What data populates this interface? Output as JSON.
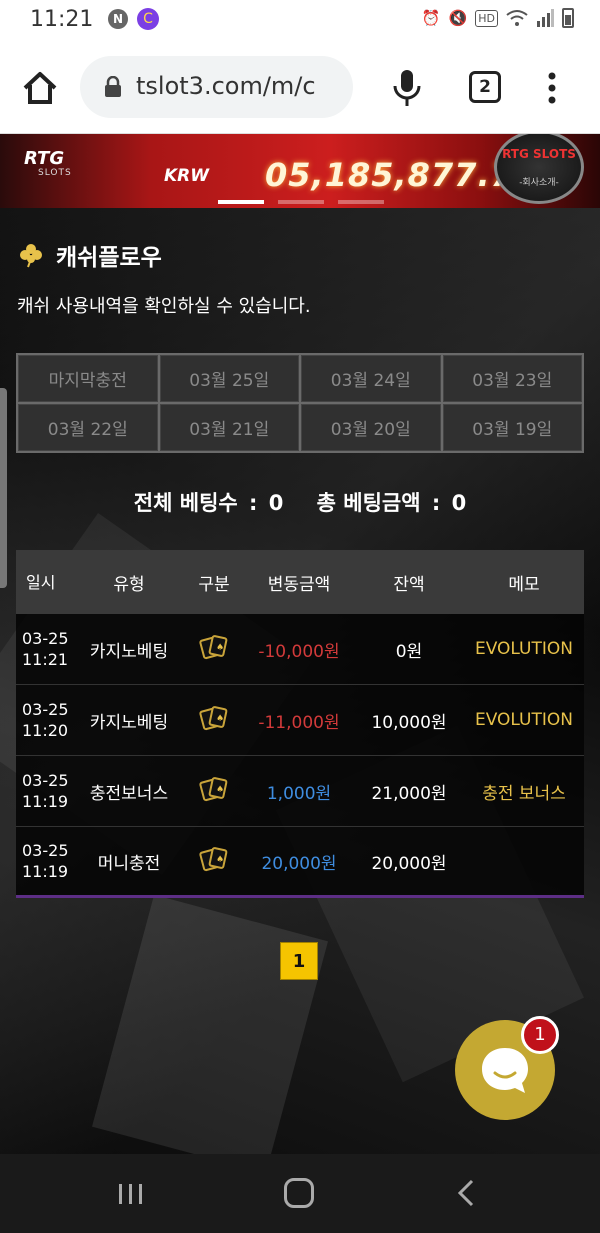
{
  "status_bar": {
    "time": "11:21",
    "notif_n": "N",
    "notif_c": "C",
    "hd_label": "HD"
  },
  "browser": {
    "url": "tslot3.com/m/c",
    "tab_count": "2"
  },
  "banner": {
    "logo": "RTG",
    "logo_sub": "SLOTS",
    "currency": "KRW",
    "jackpot": "05,185,877.7",
    "badge_title": "RTG SLOTS",
    "badge_link": "-회사소개-"
  },
  "section": {
    "title": "캐쉬플로우",
    "description": "캐쉬 사용내역을 확인하실 수 있습니다."
  },
  "date_filters": [
    "마지막충전",
    "03월 25일",
    "03월 24일",
    "03월 23일",
    "03월 22일",
    "03월 21일",
    "03월 20일",
    "03월 19일"
  ],
  "summary": {
    "total_bets_label": "전체 베팅수",
    "total_bets_value": "0",
    "total_amount_label": "총 베팅금액",
    "total_amount_value": "0"
  },
  "table": {
    "headers": [
      "일시",
      "유형",
      "구분",
      "변동금액",
      "잔액",
      "메모"
    ],
    "rows": [
      {
        "date": "03-25",
        "time": "11:21",
        "type": "카지노베팅",
        "category_icon": "cards-icon",
        "change": "-10,000원",
        "balance": "0원",
        "memo": "EVOLUTION"
      },
      {
        "date": "03-25",
        "time": "11:20",
        "type": "카지노베팅",
        "category_icon": "cards-icon",
        "change": "-11,000원",
        "balance": "10,000원",
        "memo": "EVOLUTION"
      },
      {
        "date": "03-25",
        "time": "11:19",
        "type": "충전보너스",
        "category_icon": "cards-icon",
        "change": "1,000원",
        "balance": "21,000원",
        "memo": "충전 보너스"
      },
      {
        "date": "03-25",
        "time": "11:19",
        "type": "머니충전",
        "category_icon": "cards-icon",
        "change": "20,000원",
        "balance": "20,000원",
        "memo": ""
      }
    ]
  },
  "pagination": {
    "current": "1"
  },
  "chat": {
    "unread": "1"
  },
  "colors": {
    "negative": "#d23a3a",
    "positive": "#3f8de0",
    "memo": "#e8c24b",
    "pager": "#f5c400",
    "chat": "#c4a832"
  }
}
